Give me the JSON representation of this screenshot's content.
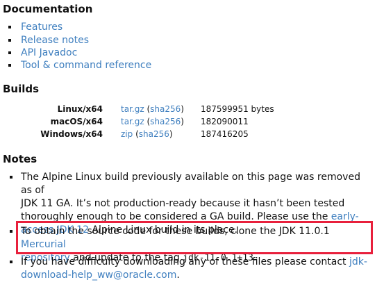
{
  "documentation": {
    "heading": "Documentation",
    "links": [
      "Features",
      "Release notes",
      "API Javadoc",
      "Tool & command reference"
    ]
  },
  "builds": {
    "heading": "Builds",
    "rows": [
      {
        "platform": "Linux/x64",
        "archive": "tar.gz",
        "sha": "sha256",
        "size": "187599951 bytes"
      },
      {
        "platform": "macOS/x64",
        "archive": "tar.gz",
        "sha": "sha256",
        "size": "182090011"
      },
      {
        "platform": "Windows/x64",
        "archive": "zip",
        "sha": "sha256",
        "size": "187416205"
      }
    ]
  },
  "notes": {
    "heading": "Notes",
    "note1_text_a": "The Alpine Linux build previously available on this page was removed as of",
    "note1_text_b": "JDK 11 GA. It’s not production-ready because it hasn’t been tested",
    "note1_text_c": "thoroughly enough to be considered a GA build. Please use the ",
    "note1_link_a": "early-",
    "note1_link_b": "access JDK 12",
    "note1_text_d": " Alpine Linux build in its place.",
    "note2_text_a": "To obtain the source code for these builds, clone the JDK 11.0.1 ",
    "note2_link_a": "Mercurial",
    "note2_link_b": "repository",
    "note2_text_b": " and update to the tag ",
    "note2_code": "jdk-11.0.1+13",
    "note2_text_c": ".",
    "note3_text_a": "If you have difficulty downloading any of these files please contact ",
    "note3_link_a": "jdk-",
    "note3_link_b": "download-help_ww@oracle.com",
    "note3_text_b": "."
  },
  "colors": {
    "link": "#3f7fbf",
    "highlight": "#e8203c"
  }
}
